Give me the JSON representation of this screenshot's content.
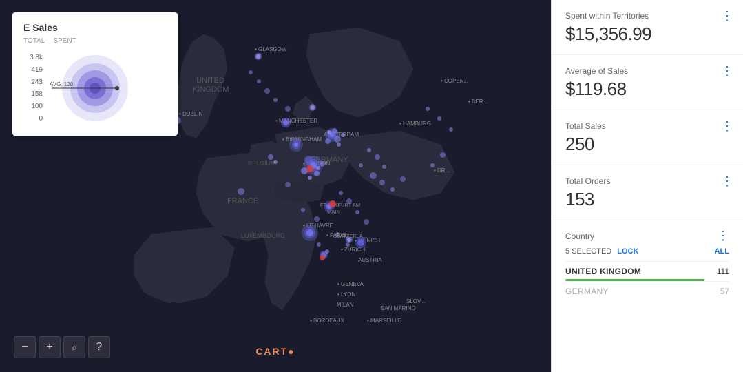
{
  "chart": {
    "title": "E Sales",
    "col1": "TOTAL",
    "col2": "SPENT",
    "y_labels": [
      "3.8k",
      "419",
      "243",
      "158",
      "100",
      "0"
    ],
    "avg_label": "AVG: 120"
  },
  "map": {
    "carto_text": "CART",
    "carto_dot": "●"
  },
  "controls": {
    "zoom_out": "−",
    "zoom_in": "+",
    "search": "⌕",
    "help": "?"
  },
  "metrics": [
    {
      "label": "Spent within Territories",
      "value": "$15,356.99"
    },
    {
      "label": "Average of Sales",
      "value": "$119.68"
    },
    {
      "label": "Total Sales",
      "value": "250"
    },
    {
      "label": "Total Orders",
      "value": "153"
    }
  ],
  "country_filter": {
    "title": "Country",
    "selected_text": "5 SELECTED",
    "lock_text": "LOCK",
    "all_text": "ALL",
    "rows": [
      {
        "name": "UNITED KINGDOM",
        "count": "111",
        "selected": true,
        "bar_pct": 85
      },
      {
        "name": "GERMANY",
        "count": "57",
        "selected": false,
        "bar_pct": 0
      }
    ]
  }
}
